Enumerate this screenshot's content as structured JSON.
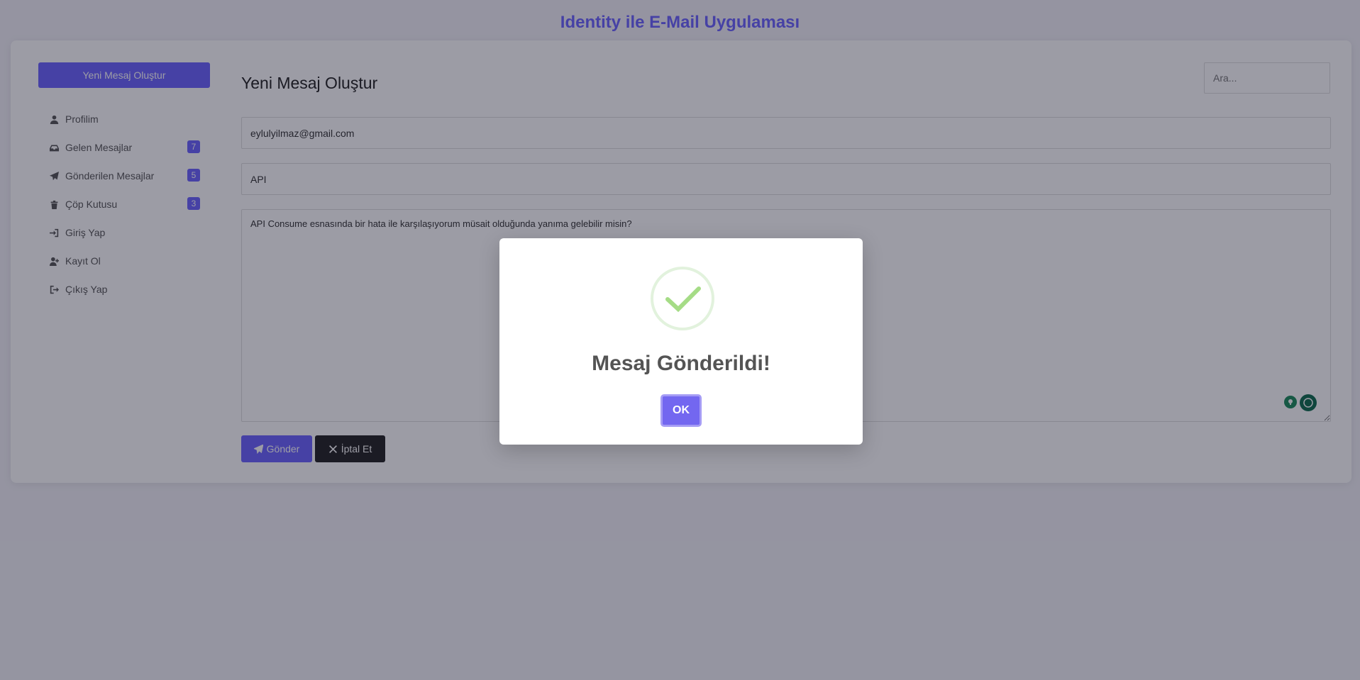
{
  "app": {
    "title": "Identity ile E-Mail Uygulaması"
  },
  "sidebar": {
    "compose_label": "Yeni Mesaj Oluştur",
    "items": [
      {
        "label": "Profilim",
        "icon": "user-icon"
      },
      {
        "label": "Gelen Mesajlar",
        "icon": "inbox-icon",
        "badge": "7"
      },
      {
        "label": "Gönderilen Mesajlar",
        "icon": "paper-plane-icon",
        "badge": "5"
      },
      {
        "label": "Çöp Kutusu",
        "icon": "trash-icon",
        "badge": "3"
      },
      {
        "label": "Giriş Yap",
        "icon": "sign-in-icon"
      },
      {
        "label": "Kayıt Ol",
        "icon": "user-plus-icon"
      },
      {
        "label": "Çıkış Yap",
        "icon": "sign-out-icon"
      }
    ]
  },
  "main": {
    "heading": "Yeni Mesaj Oluştur",
    "search_placeholder": "Ara...",
    "to_value": "eylulyilmaz@gmail.com",
    "subject_value": "API",
    "body_value": "API Consume esnasında bir hata ile karşılaşıyorum müsait olduğunda yanıma gelebilir misin?",
    "send_label": "Gönder",
    "cancel_label": "İptal Et"
  },
  "modal": {
    "title": "Mesaj Gönderildi!",
    "ok_label": "OK",
    "icon": "check-circle-icon"
  },
  "colors": {
    "accent": "#6c63ff",
    "success": "#a5dc86",
    "dark_button": "#222222"
  }
}
